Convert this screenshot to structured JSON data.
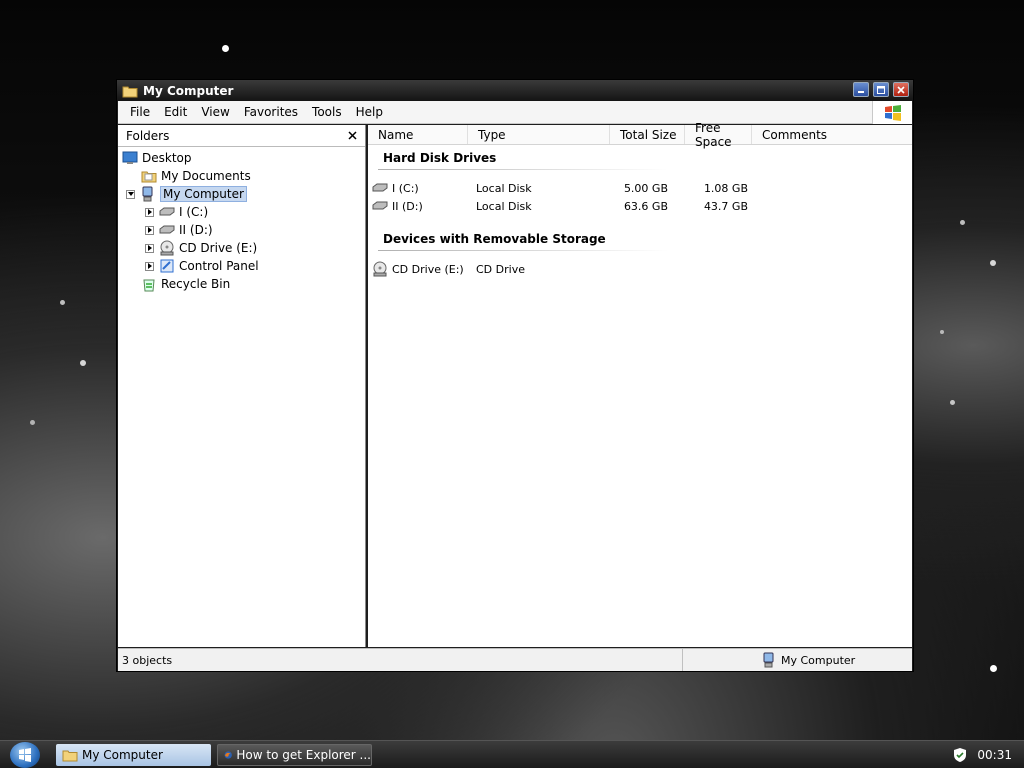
{
  "window": {
    "title": "My Computer",
    "menu": [
      "File",
      "Edit",
      "View",
      "Favorites",
      "Tools",
      "Help"
    ]
  },
  "folders_pane": {
    "title": "Folders",
    "items": [
      {
        "label": "Desktop",
        "icon": "desktop-icon"
      },
      {
        "label": "My Documents",
        "icon": "folder-documents-icon"
      },
      {
        "label": "My Computer",
        "icon": "computer-icon",
        "expanded": true,
        "selected": true
      },
      {
        "label": "I (C:)",
        "icon": "hard-drive-icon"
      },
      {
        "label": "II (D:)",
        "icon": "hard-drive-icon"
      },
      {
        "label": "CD Drive (E:)",
        "icon": "cd-drive-icon"
      },
      {
        "label": "Control Panel",
        "icon": "control-panel-icon"
      },
      {
        "label": "Recycle Bin",
        "icon": "recycle-bin-icon"
      }
    ]
  },
  "columns": [
    "Name",
    "Type",
    "Total Size",
    "Free Space",
    "Comments"
  ],
  "groups": [
    {
      "title": "Hard Disk Drives",
      "rows": [
        {
          "name": "I (C:)",
          "type": "Local Disk",
          "total": "5.00 GB",
          "free": "1.08 GB"
        },
        {
          "name": "II (D:)",
          "type": "Local Disk",
          "total": "63.6 GB",
          "free": "43.7 GB"
        }
      ]
    },
    {
      "title": "Devices with Removable Storage",
      "rows": [
        {
          "name": "CD Drive (E:)",
          "type": "CD Drive",
          "total": "",
          "free": ""
        }
      ]
    }
  ],
  "statusbar": {
    "left": "3 objects",
    "right": "My Computer"
  },
  "taskbar": {
    "tasks": [
      "My Computer",
      "How to get Explorer ..."
    ],
    "clock": "00:31"
  },
  "colors": {
    "selection": "#c6d8f0",
    "accent": "#2c6fbf"
  }
}
